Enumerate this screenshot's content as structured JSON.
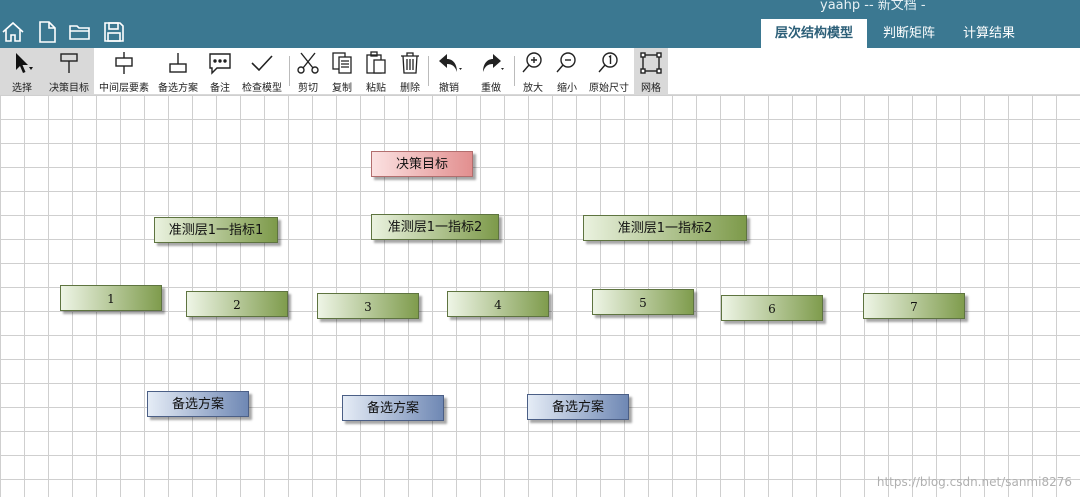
{
  "window": {
    "title": "yaahp -- 新文档 -"
  },
  "quick_actions": [
    {
      "name": "home-icon"
    },
    {
      "name": "new-document-icon"
    },
    {
      "name": "open-folder-icon"
    },
    {
      "name": "save-icon"
    }
  ],
  "tabs": [
    {
      "label": "层次结构模型",
      "active": true
    },
    {
      "label": "判断矩阵",
      "active": false
    },
    {
      "label": "计算结果",
      "active": false
    }
  ],
  "toolbar": {
    "select": "选择",
    "goal": "决策目标",
    "middle": "中间层要素",
    "alternative": "备选方案",
    "note": "备注",
    "check": "检查模型",
    "cut": "剪切",
    "copy": "复制",
    "paste": "粘贴",
    "delete": "删除",
    "undo": "撤销",
    "redo": "重做",
    "zoom_in": "放大",
    "zoom_out": "缩小",
    "original_size": "原始尺寸",
    "grid": "网格"
  },
  "model": {
    "goal": "决策目标",
    "criteria": [
      "准测层1一指标1",
      "准测层1一指标2",
      "准测层1一指标2"
    ],
    "subcriteria": [
      "1",
      "2",
      "3",
      "4",
      "5",
      "6",
      "7"
    ],
    "alternatives": [
      "备选方案",
      "备选方案",
      "备选方案"
    ]
  },
  "watermark": "https://blog.csdn.net/sanmi8276"
}
